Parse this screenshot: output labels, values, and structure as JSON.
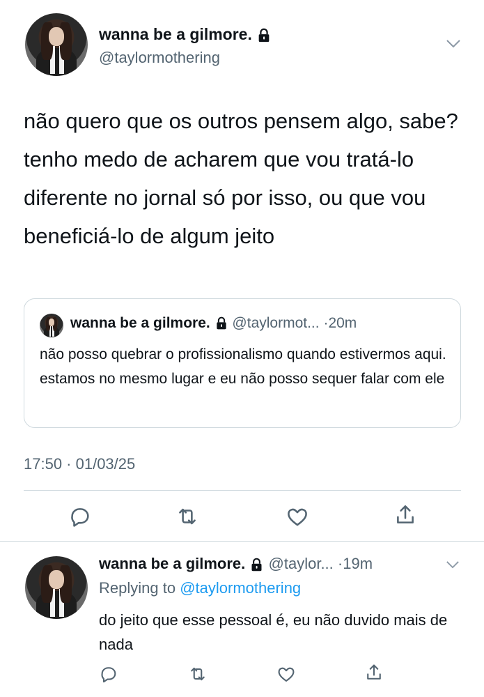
{
  "main_tweet": {
    "display_name": "wanna be a gilmore.",
    "handle": "@taylormothering",
    "text": "não quero que os outros pensem algo, sabe? tenho medo de acharem que vou tratá-lo diferente no jornal só por isso, ou que vou beneficiá-lo de algum jeito",
    "timestamp": "17:50 · 01/03/25"
  },
  "quoted_tweet": {
    "display_name": "wanna be a gilmore.",
    "handle": "@taylormot...",
    "age": "·20m",
    "text": "não posso quebrar o profissionalismo quando estivermos aqui. estamos no mesmo lugar e eu não posso sequer falar com ele"
  },
  "reply_tweet": {
    "display_name": "wanna be a gilmore.",
    "handle": "@taylor...",
    "age": "·19m",
    "replying_label": "Replying to",
    "replying_handle": "@taylormothering",
    "text": "do jeito que esse pessoal é, eu não duvido mais de nada"
  },
  "icons": {
    "reply": "reply-icon",
    "retweet": "retweet-icon",
    "like": "like-icon",
    "share": "share-icon",
    "lock": "lock-icon",
    "chevron": "chevron-down-icon"
  },
  "colors": {
    "text": "#0f1419",
    "secondary": "#536471",
    "link": "#1d9bf0",
    "border": "#cfd9de"
  }
}
